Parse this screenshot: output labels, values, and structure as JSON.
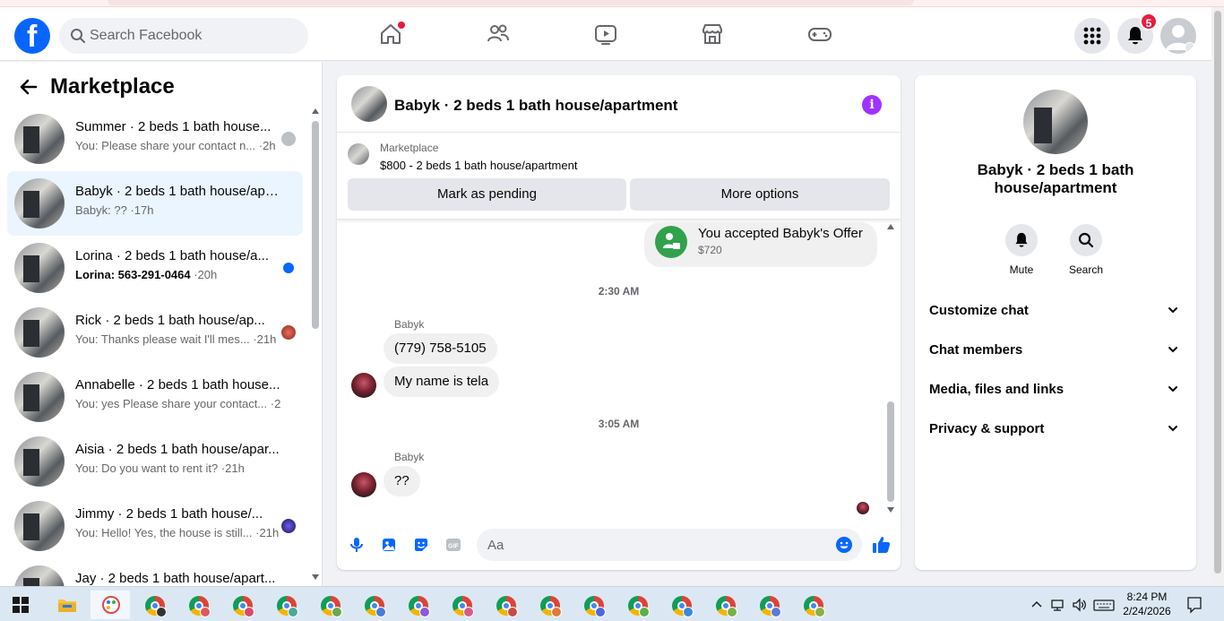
{
  "header": {
    "search_placeholder": "Search Facebook",
    "notifications_count": "5",
    "accent": "#0866ff"
  },
  "sidebar": {
    "title": "Marketplace",
    "conversations": [
      {
        "title": "Summer · 2 beds 1 bath house...",
        "preview": "You: Please share your contact n...",
        "time": " ·2h",
        "unread": false,
        "active": false
      },
      {
        "title": "Babyk · 2 beds 1 bath house/apa...",
        "preview": "Babyk: ??",
        "time": " ·17h",
        "unread": false,
        "active": true
      },
      {
        "title": "Lorina · 2 beds 1 bath house/a...",
        "preview": "Lorina: 563-291-0464",
        "time": " ·20h",
        "unread": true,
        "active": false
      },
      {
        "title": "Rick · 2 beds 1 bath house/ap...",
        "preview": "You: Thanks please wait I'll mes...",
        "time": " ·21h",
        "unread": false,
        "active": false
      },
      {
        "title": "Annabelle · 2 beds 1 bath house...",
        "preview": "You: yes Please share your contact...",
        "time": " ·21h",
        "unread": false,
        "active": false
      },
      {
        "title": "Aisia · 2 beds 1 bath house/apar...",
        "preview": "You: Do you want to rent it?",
        "time": " ·21h",
        "unread": false,
        "active": false
      },
      {
        "title": "Jimmy · 2 beds 1 bath house/...",
        "preview": "You: Hello! Yes, the house is still...",
        "time": " ·21h",
        "unread": false,
        "active": false
      },
      {
        "title": "Jay · 2 beds 1 bath house/apart...",
        "preview": "",
        "time": "",
        "unread": false,
        "active": false
      }
    ]
  },
  "chat": {
    "title": "Babyk · 2 beds 1 bath house/apartment",
    "listing": {
      "label": "Marketplace",
      "detail": "$800 - 2 beds 1 bath house/apartment",
      "mark_pending": "Mark as pending",
      "more_options": "More options"
    },
    "offer": {
      "title": "You accepted Babyk's Offer",
      "amount": "$720"
    },
    "timestamps": [
      "2:30 AM",
      "3:05 AM"
    ],
    "sender": "Babyk",
    "messages_group1": [
      "(779) 758-5105",
      "My name is tela"
    ],
    "messages_group2": [
      "??"
    ],
    "input_placeholder": "Aa"
  },
  "details": {
    "title": "Babyk · 2 beds 1 bath house/apartment",
    "mute_label": "Mute",
    "search_label": "Search",
    "sections": [
      "Customize chat",
      "Chat members",
      "Media, files and links",
      "Privacy & support"
    ]
  },
  "taskbar": {
    "time": "8:24 PM",
    "date": "2/24/2026"
  }
}
